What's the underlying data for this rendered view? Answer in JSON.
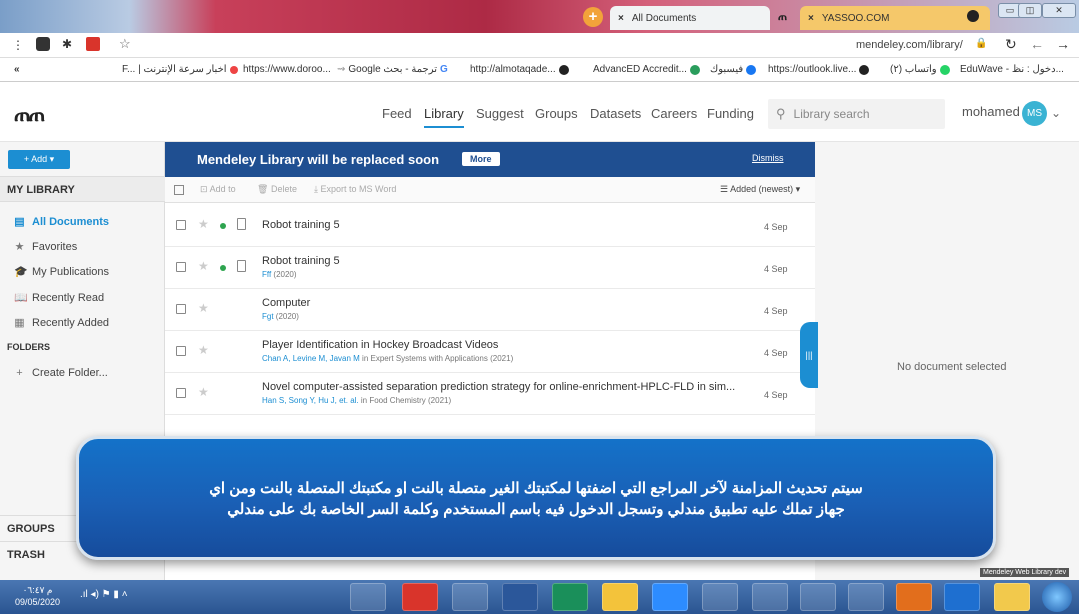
{
  "browser": {
    "tabs": [
      {
        "label": "All Documents",
        "close": "×"
      },
      {
        "label": "YASSOO.COM",
        "close": "×"
      }
    ],
    "new_tab": "+",
    "url": "mendeley.com/library/",
    "bookmarks": [
      {
        "label": "F... | اخبار سرعة الإنترنت"
      },
      {
        "label": "https://www.doroo..."
      },
      {
        "label": "Google ترجمة - بحث"
      },
      {
        "label": "http://almotaqade..."
      },
      {
        "label": "AdvancED Accredit..."
      },
      {
        "label": "فيسبوك"
      },
      {
        "label": "https://outlook.live..."
      },
      {
        "label": "(٢) واتساب"
      },
      {
        "label": "EduWave - دخول : نظ..."
      }
    ],
    "bookmarks_more": "«"
  },
  "header": {
    "nav": [
      "Feed",
      "Library",
      "Suggest",
      "Groups",
      "Datasets",
      "Careers",
      "Funding"
    ],
    "search_placeholder": "Library search",
    "user": "mohamed",
    "avatar": "MS"
  },
  "sidebar": {
    "add_label": "+ Add ▾",
    "my_library": "MY LIBRARY",
    "items": [
      {
        "label": "All Documents",
        "icon": "document-icon"
      },
      {
        "label": "Favorites",
        "icon": "star-icon"
      },
      {
        "label": "My Publications",
        "icon": "graduation-icon"
      },
      {
        "label": "Recently Read",
        "icon": "book-icon"
      },
      {
        "label": "Recently Added",
        "icon": "inbox-icon"
      }
    ],
    "folders": "FOLDERS",
    "create_folder": "Create Folder...",
    "groups": "GROUPS",
    "trash": "TRASH"
  },
  "banner": {
    "title": "Mendeley Library will be replaced soon",
    "more": "More",
    "dismiss": "Dismiss"
  },
  "toolbar": {
    "add_to": "Add to",
    "delete": "Delete",
    "export": "Export to MS Word",
    "sort": "Added (newest)"
  },
  "documents": [
    {
      "title": "Robot training 5",
      "authors": "",
      "rest": "",
      "date": "4 Sep"
    },
    {
      "title": "Robot training 5",
      "authors": "Fff",
      "rest": " (2020)",
      "date": "4 Sep"
    },
    {
      "title": "Computer",
      "authors": "Fgt",
      "rest": " (2020)",
      "date": "4 Sep"
    },
    {
      "title": "Player Identification in Hockey Broadcast Videos",
      "authors": "Chan A, Levine M, Javan M",
      "rest": " in Expert Systems with Applications (2021)",
      "date": "4 Sep"
    },
    {
      "title": "Novel computer-assisted separation prediction strategy for online-enrichment-HPLC-FLD in sim...",
      "authors": "Han S, Song Y, Hu J, et. al.",
      "rest": " in Food Chemistry (2021)",
      "date": "4 Sep"
    }
  ],
  "right_pane": {
    "empty": "No document selected"
  },
  "overlay": {
    "line1": "سيتم تحديث المزامنة لآخر المراجع التي اضفتها لمكتبتك الغير متصلة بالنت او مكتبتك المتصلة بالنت ومن اي",
    "line2": "جهاز تملك عليه تطبيق مندلي وتسجل الدخول فيه باسم المستخدم وكلمة السر الخاصة بك على مندلي"
  },
  "taskbar": {
    "time": "م ٠٦:٤٧",
    "date": "09/05/2020",
    "footnote": "Mendeley Web Library dev"
  }
}
